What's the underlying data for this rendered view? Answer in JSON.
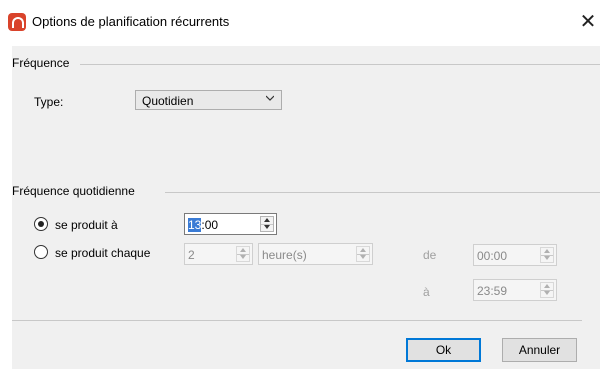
{
  "window": {
    "title": "Options de planification récurrents",
    "close_glyph": "✕"
  },
  "frequence": {
    "group_label": "Fréquence",
    "type_label": "Type:",
    "type_value": "Quotidien"
  },
  "daily": {
    "group_label": "Fréquence quotidienne",
    "occurs_at_label": "se produit à",
    "occurs_at_selected": true,
    "occurs_at_time_hl": "13",
    "occurs_at_time_rest": ":00",
    "occurs_every_label": "se produit chaque",
    "occurs_every_selected": false,
    "every_value": "2",
    "every_unit": "heure(s)",
    "from_label": "de",
    "from_value": "00:00",
    "to_label": "à",
    "to_value": "23:59"
  },
  "buttons": {
    "ok": "Ok",
    "cancel": "Annuler"
  },
  "icons": {
    "app": "app-logo-icon",
    "close": "close-icon",
    "chevron": "chevron-down-icon",
    "spin_up": "spin-up-icon",
    "spin_down": "spin-down-icon"
  },
  "colors": {
    "app_icon": "#d9432b",
    "selection": "#3a7bd5",
    "default_button_border": "#0078d7",
    "dialog_bg": "#f0f0f0"
  }
}
